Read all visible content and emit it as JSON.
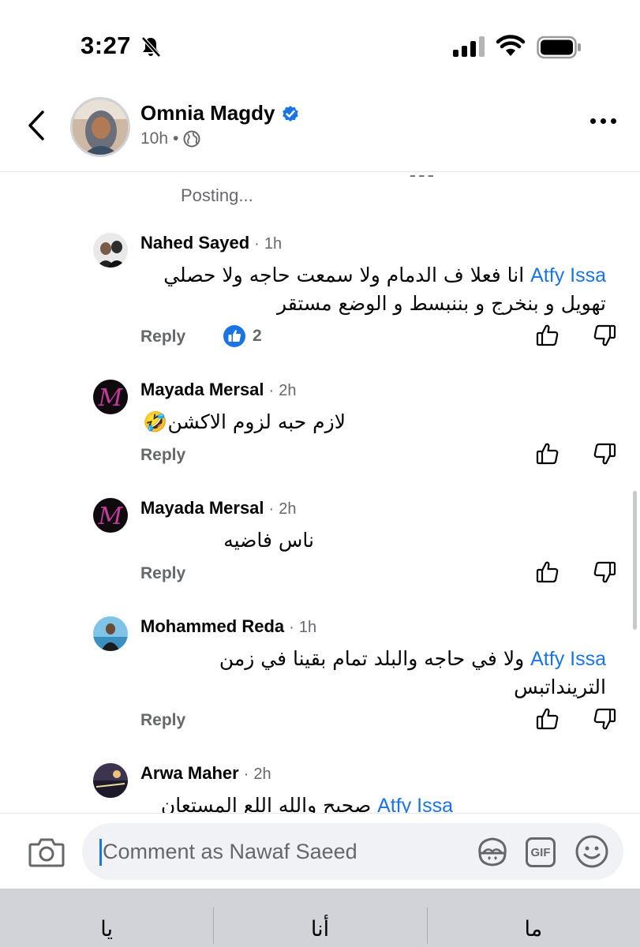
{
  "status_bar": {
    "time": "3:27"
  },
  "post": {
    "author": "Omnia Magdy",
    "verified": true,
    "time": "10h",
    "meta_dot": "•",
    "audience_icon": "globe-icon"
  },
  "comments_area": {
    "cut_text": "ـ ـ ـ",
    "posting_label": "Posting..."
  },
  "comments": [
    {
      "name": "Nahed Sayed",
      "dot": "·",
      "time": "1h",
      "mention": "Atfy Issa",
      "text": " انا فعلا ف الدمام ولا سمعت حاجه ولا حصلي تهويل و بنخرج و بننبسط و الوضع مستقر",
      "reply_label": "Reply",
      "reaction_count": "2"
    },
    {
      "name": "Mayada Mersal",
      "dot": "·",
      "time": "2h",
      "text": "لازم حبه لزوم الاكشن🤣",
      "reply_label": "Reply"
    },
    {
      "name": "Mayada Mersal",
      "dot": "·",
      "time": "2h",
      "text": "ناس فاضيه",
      "reply_label": "Reply"
    },
    {
      "name": "Mohammed Reda",
      "dot": "·",
      "time": "1h",
      "mention": "Atfy Issa",
      "text": " ولا في حاجه والبلد تمام بقينا في زمن الترينداتبس",
      "reply_label": "Reply"
    },
    {
      "name": "Arwa Maher",
      "dot": "·",
      "time": "2h",
      "mention": "Atfy Issa",
      "text": " صحيح والله اللع المستعان"
    }
  ],
  "composer": {
    "placeholder": "Comment as Nawaf Saeed",
    "gif_label": "GIF"
  },
  "keyboard_suggestions": [
    "يا",
    "أنا",
    "ما"
  ],
  "colors": {
    "accent": "#1b74e4",
    "secondary_text": "#65676b",
    "input_bg": "#f0f2f5",
    "keyboard_bg": "#d1d3d9"
  }
}
